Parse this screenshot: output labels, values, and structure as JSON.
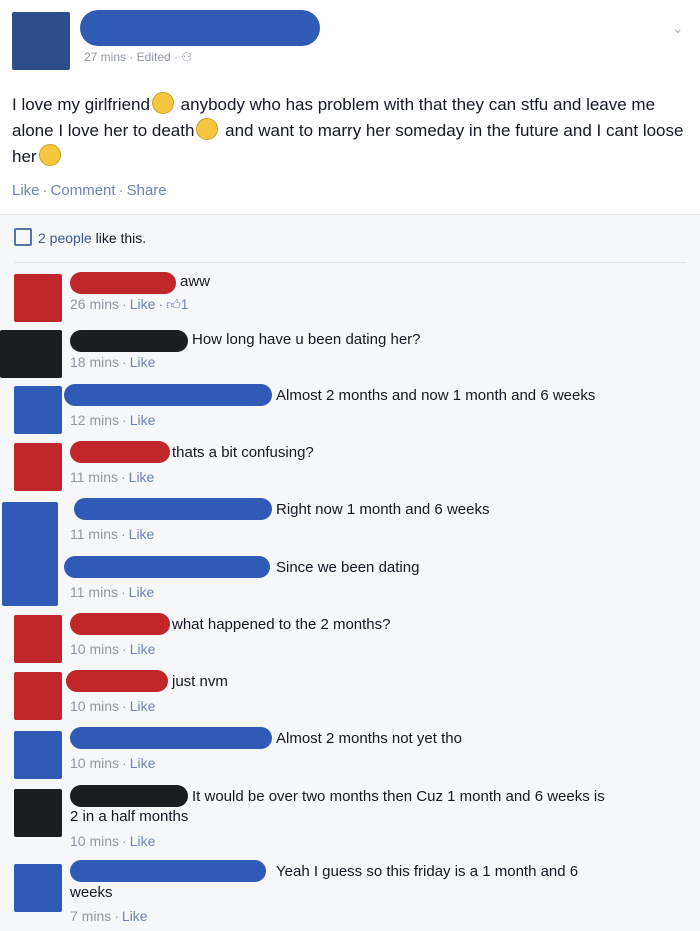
{
  "post": {
    "meta": "27 mins · Edited · ",
    "text_1": "I love my girlfriend",
    "text_2": " anybody who has problem with that they can stfu and leave me alone I love her to death",
    "text_3": " and want to marry her someday in the future and I cant loose her",
    "actions": {
      "like": "Like",
      "comment": "Comment",
      "share": "Share"
    }
  },
  "likes": {
    "count_text": "2 people",
    "suffix": " like this."
  },
  "comments": [
    {
      "text": "aww",
      "time": "26 mins",
      "like": "Like",
      "likes": "1",
      "color": "red"
    },
    {
      "text": "How long have u been dating her?",
      "time": "18 mins",
      "like": "Like",
      "color": "dark"
    },
    {
      "text": "Almost 2 months and now 1 month and 6 weeks",
      "time": "12 mins",
      "like": "Like",
      "color": "blue"
    },
    {
      "text": "thats a bit confusing?",
      "time": "11 mins",
      "like": "Like",
      "color": "red"
    },
    {
      "text": "Right now 1 month and 6 weeks",
      "time": "11 mins",
      "like": "Like",
      "color": "blue"
    },
    {
      "text": "Since we been dating",
      "time": "11 mins",
      "like": "Like",
      "color": "blue"
    },
    {
      "text": "what happened to the 2 months?",
      "time": "10 mins",
      "like": "Like",
      "color": "red"
    },
    {
      "text": "just nvm",
      "time": "10 mins",
      "like": "Like",
      "color": "red"
    },
    {
      "text": "Almost 2 months not yet tho",
      "time": "10 mins",
      "like": "Like",
      "color": "blue"
    },
    {
      "text": "It would be over two months then Cuz 1 month and 6 weeks is",
      "text_2": "2 in a half months",
      "time": "10 mins",
      "like": "Like",
      "color": "dark"
    },
    {
      "text": "Yeah I guess so this friday is a 1 month and 6",
      "text_2": "weeks",
      "time": "7 mins",
      "like": "Like",
      "color": "blue"
    }
  ]
}
